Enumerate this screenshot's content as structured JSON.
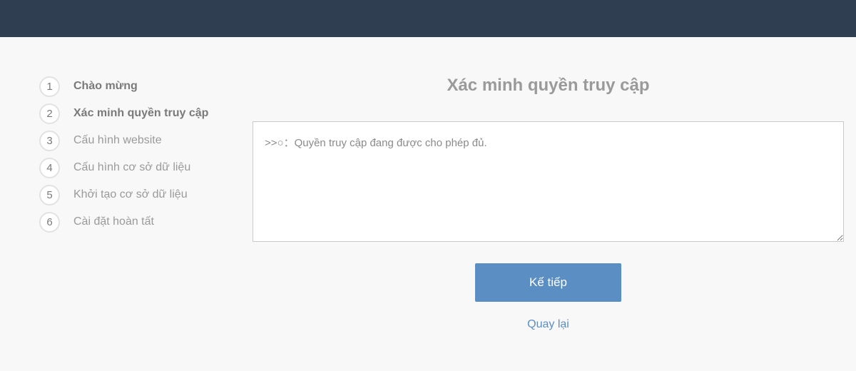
{
  "steps": [
    {
      "number": "1",
      "label": "Chào mừng",
      "state": "done"
    },
    {
      "number": "2",
      "label": "Xác minh quyền truy cập",
      "state": "active"
    },
    {
      "number": "3",
      "label": "Cấu hình website",
      "state": "pending"
    },
    {
      "number": "4",
      "label": "Cấu hình cơ sở dữ liệu",
      "state": "pending"
    },
    {
      "number": "5",
      "label": "Khởi tạo cơ sở dữ liệu",
      "state": "pending"
    },
    {
      "number": "6",
      "label": "Cài đặt hoàn tất",
      "state": "pending"
    }
  ],
  "main": {
    "title": "Xác minh quyền truy cập",
    "log_text": ">>○：Quyền truy cập đang được cho phép đủ.",
    "next_label": "Kế tiếp",
    "back_label": "Quay lại"
  },
  "colors": {
    "header": "#2f3e50",
    "background": "#f8f8f8",
    "accent": "#5b8ec3"
  }
}
